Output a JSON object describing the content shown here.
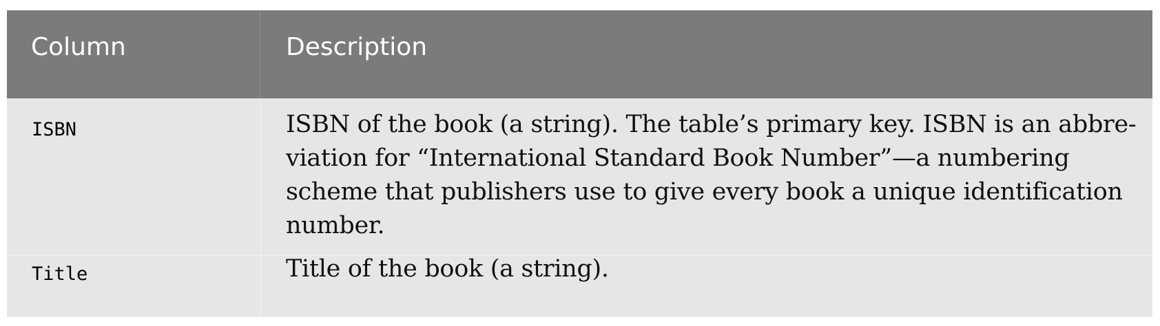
{
  "table": {
    "headers": [
      "Column",
      "Description"
    ],
    "rows": [
      {
        "column": "ISBN",
        "description_lines": [
          "ISBN of the book (a string). The table’s primary key. ISBN is an abbre-",
          "viation for “International Standard Book Number”—a numbering",
          "scheme that publishers use to give every book a unique identification",
          "number."
        ]
      },
      {
        "column": "Title",
        "description_lines": [
          "Title of the book (a string)."
        ]
      }
    ]
  }
}
